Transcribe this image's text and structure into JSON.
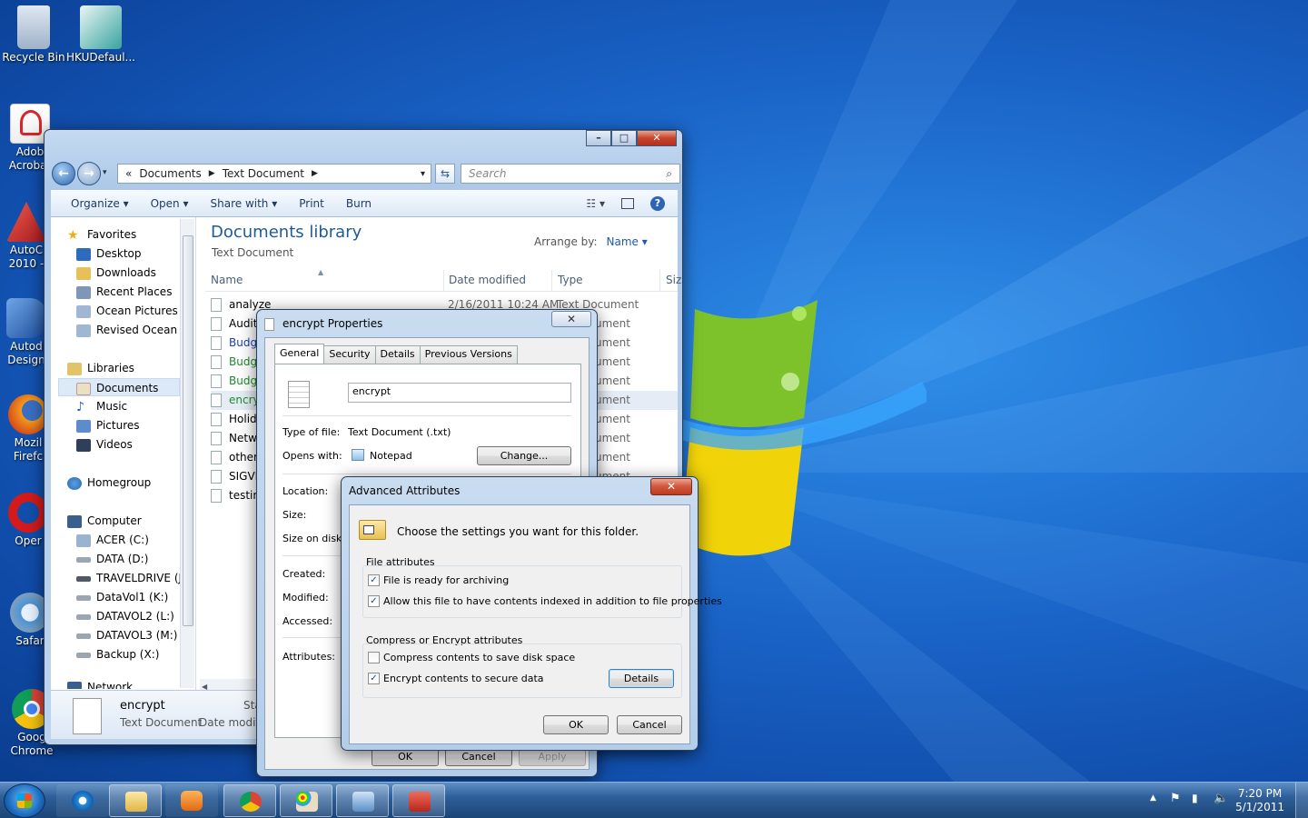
{
  "desktop": {
    "icons": [
      {
        "label": "Recycle Bin",
        "icon": "recycle-bin-icon",
        "color": "#b9c8d8"
      },
      {
        "label": "HKUDefaul...",
        "icon": "registry-file-icon",
        "color": "#3aa3a0"
      },
      {
        "label1": "Adob",
        "label2": "Acrobat",
        "icon": "adobe-acrobat-icon",
        "color": "#d7262b"
      },
      {
        "label1": "AutoC",
        "label2": "2010 -",
        "icon": "autocad-icon",
        "color": "#c6262b"
      },
      {
        "label1": "Autod",
        "label2": "Design",
        "icon": "autodesk-design-icon",
        "color": "#1d4e9e"
      },
      {
        "label1": "Mozil",
        "label2": "Firefc",
        "icon": "firefox-icon",
        "color": "#e8761c"
      },
      {
        "label1": "Oper",
        "icon": "opera-icon",
        "color": "#d31b1b"
      },
      {
        "label1": "Safar",
        "icon": "safari-icon",
        "color": "#4b95d6"
      },
      {
        "label1": "Goog",
        "label2": "Chrome",
        "icon": "chrome-icon",
        "color": "#3aa048"
      }
    ]
  },
  "explorer": {
    "breadcrumb": [
      "«",
      "Documents",
      "Text Document"
    ],
    "search_placeholder": "Search",
    "toolbar": [
      "Organize ▾",
      "Open ▾",
      "Share with ▾",
      "Print",
      "Burn"
    ],
    "nav": {
      "favorites": "Favorites",
      "fav_items": [
        "Desktop",
        "Downloads",
        "Recent Places",
        "Ocean Pictures",
        "Revised Ocean Pi"
      ],
      "libraries": "Libraries",
      "lib_items": [
        "Documents",
        "Music",
        "Pictures",
        "Videos"
      ],
      "homegroup": "Homegroup",
      "computer": "Computer",
      "drives": [
        "ACER (C:)",
        "DATA (D:)",
        "TRAVELDRIVE (J:)",
        "DataVol1 (K:)",
        "DATAVOL2 (L:)",
        "DATAVOL3 (M:)",
        "Backup (X:)"
      ],
      "network": "Network"
    },
    "library_title": "Documents library",
    "library_sub": "Text Document",
    "arrange_label": "Arrange by:",
    "arrange_value": "Name ▾",
    "columns": [
      "Name",
      "Date modified",
      "Type",
      "Siz"
    ],
    "files": [
      {
        "name": "analyze",
        "date": "2/16/2011 10:24 AM",
        "type": "Text Document",
        "color": "#000"
      },
      {
        "name": "Audit",
        "type": "ument",
        "color": "#000"
      },
      {
        "name": "Budge",
        "type": "ument",
        "color": "#1a3fb0"
      },
      {
        "name": "Budge",
        "type": "ument",
        "color": "#1f8a2c"
      },
      {
        "name": "Budge",
        "type": "ument",
        "color": "#1f8a2c"
      },
      {
        "name": "encry",
        "type": "ument",
        "color": "#1f8a2c"
      },
      {
        "name": "Holid",
        "type": "ument",
        "color": "#000"
      },
      {
        "name": "Netw",
        "type": "ument",
        "color": "#000"
      },
      {
        "name": "other",
        "type": "ument",
        "color": "#000"
      },
      {
        "name": "SIGVE",
        "type": "ument",
        "color": "#000"
      },
      {
        "name": "testin",
        "type": "",
        "color": "#000"
      }
    ],
    "details": {
      "name": "encrypt",
      "type": "Text Document",
      "date_label": "Date modifi",
      "state_label": "Sta"
    }
  },
  "properties": {
    "title": "encrypt Properties",
    "close": "✕",
    "tabs": [
      "General",
      "Security",
      "Details",
      "Previous Versions"
    ],
    "filename": "encrypt",
    "type_label": "Type of file:",
    "type_value": "Text Document (.txt)",
    "opens_label": "Opens with:",
    "opens_value": "Notepad",
    "change_button": "Change...",
    "location_label": "Location:",
    "size_label": "Size:",
    "size_disk_label": "Size on disk:",
    "created_label": "Created:",
    "modified_label": "Modified:",
    "accessed_label": "Accessed:",
    "attributes_label": "Attributes:",
    "ok": "OK",
    "cancel": "Cancel",
    "apply": "Apply"
  },
  "advanced": {
    "title": "Advanced Attributes",
    "close": "✕",
    "description": "Choose the settings you want for this folder.",
    "file_attributes_label": "File attributes",
    "archive_label": "File is ready for archiving",
    "archive_checked": true,
    "index_label": "Allow this file to have contents indexed in addition to file properties",
    "index_checked": true,
    "compress_group_label": "Compress or Encrypt attributes",
    "compress_label": "Compress contents to save disk space",
    "compress_checked": false,
    "encrypt_label": "Encrypt contents to secure data",
    "encrypt_checked": true,
    "details_button": "Details",
    "ok": "OK",
    "cancel": "Cancel"
  },
  "taskbar": {
    "time": "7:20 PM",
    "date": "5/1/2011"
  }
}
